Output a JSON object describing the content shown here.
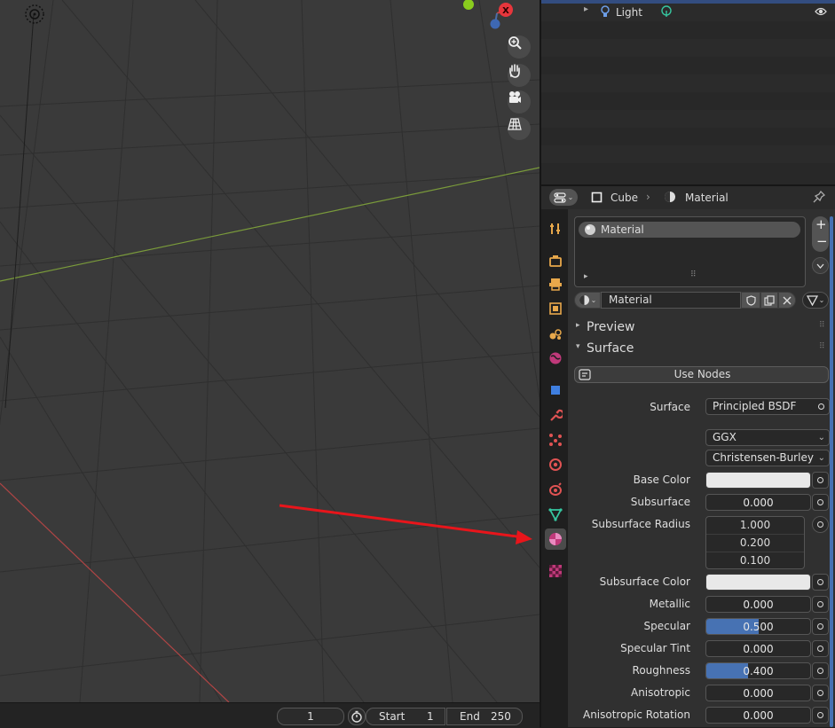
{
  "outliner": {
    "light_label": "Light"
  },
  "properties": {
    "breadcrumb_object": "Cube",
    "breadcrumb_material": "Material",
    "slot_name": "Material",
    "material_name": "Material",
    "panels": {
      "preview": "Preview",
      "surface": "Surface"
    },
    "use_nodes_label": "Use Nodes",
    "surface": {
      "label": "Surface",
      "value": "Principled BSDF"
    },
    "distribution": "GGX",
    "subsurface_method": "Christensen-Burley",
    "base_color": {
      "label": "Base Color",
      "color": "#e8e8e8"
    },
    "subsurface": {
      "label": "Subsurface",
      "value": "0.000"
    },
    "subsurface_radius": {
      "label": "Subsurface Radius",
      "values": [
        "1.000",
        "0.200",
        "0.100"
      ]
    },
    "subsurface_color": {
      "label": "Subsurface Color",
      "color": "#e8e8e8"
    },
    "metallic": {
      "label": "Metallic",
      "value": "0.000"
    },
    "specular": {
      "label": "Specular",
      "value": "0.500",
      "fill": 0.5
    },
    "specular_tint": {
      "label": "Specular Tint",
      "value": "0.000"
    },
    "roughness": {
      "label": "Roughness",
      "value": "0.400",
      "fill": 0.4
    },
    "anisotropic": {
      "label": "Anisotropic",
      "value": "0.000"
    },
    "anisotropic_rotation": {
      "label": "Anisotropic Rotation",
      "value": "0.000"
    }
  },
  "timeline": {
    "current_frame": "1",
    "start_label": "Start",
    "start_value": "1",
    "end_label": "End",
    "end_value": "250"
  },
  "colors": {
    "accent": "#4772b3",
    "annotation_arrow": "#e8151b"
  }
}
